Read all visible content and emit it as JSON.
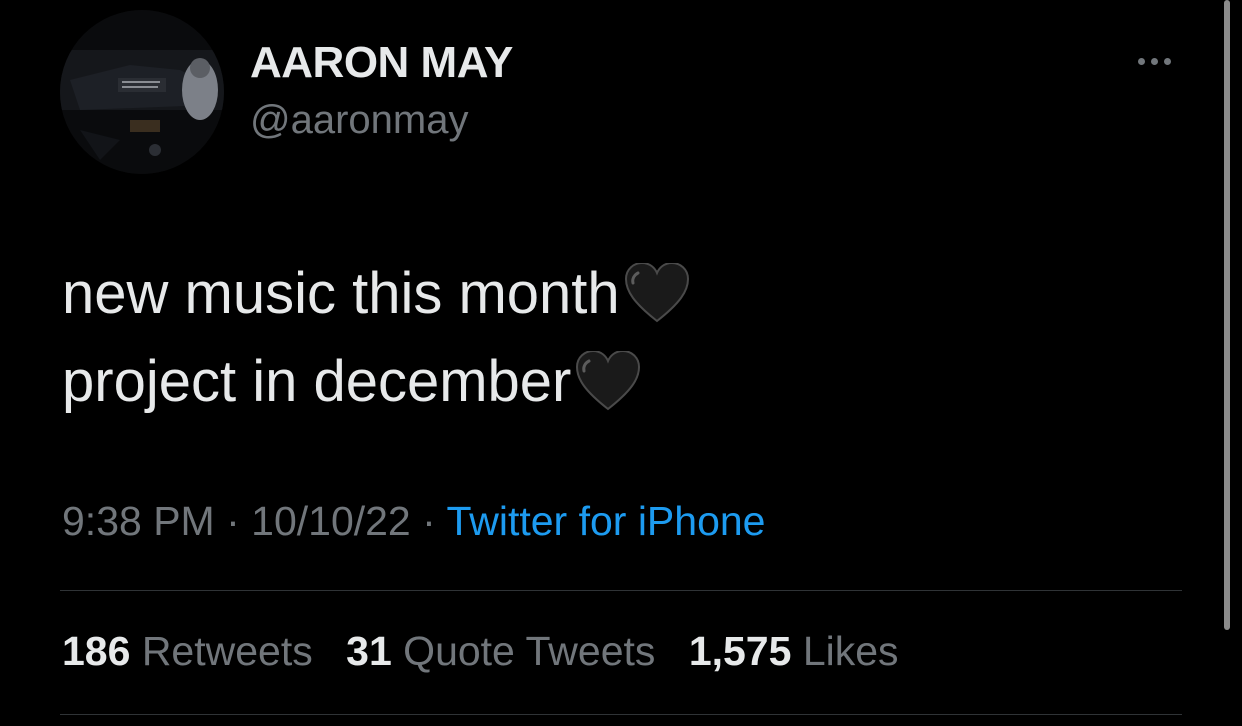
{
  "author": {
    "display_name": "AARON MAY",
    "handle": "@aaronmay",
    "avatar_alt": "profile-photo"
  },
  "tweet": {
    "lines": [
      {
        "text": "new music this month",
        "emoji": "black-heart"
      },
      {
        "text": "project in december",
        "emoji": "black-heart"
      }
    ]
  },
  "meta": {
    "time": "9:38 PM",
    "separator1": " · ",
    "date": "10/10/22",
    "separator2": " · ",
    "source": "Twitter for iPhone"
  },
  "stats": {
    "retweets_count": "186",
    "retweets_label": "Retweets",
    "quotes_count": "31",
    "quotes_label": "Quote Tweets",
    "likes_count": "1,575",
    "likes_label": "Likes"
  },
  "colors": {
    "background": "#000000",
    "text": "#e7e9ea",
    "secondary": "#71767b",
    "link": "#1d9bf0",
    "divider": "#2f3336"
  }
}
